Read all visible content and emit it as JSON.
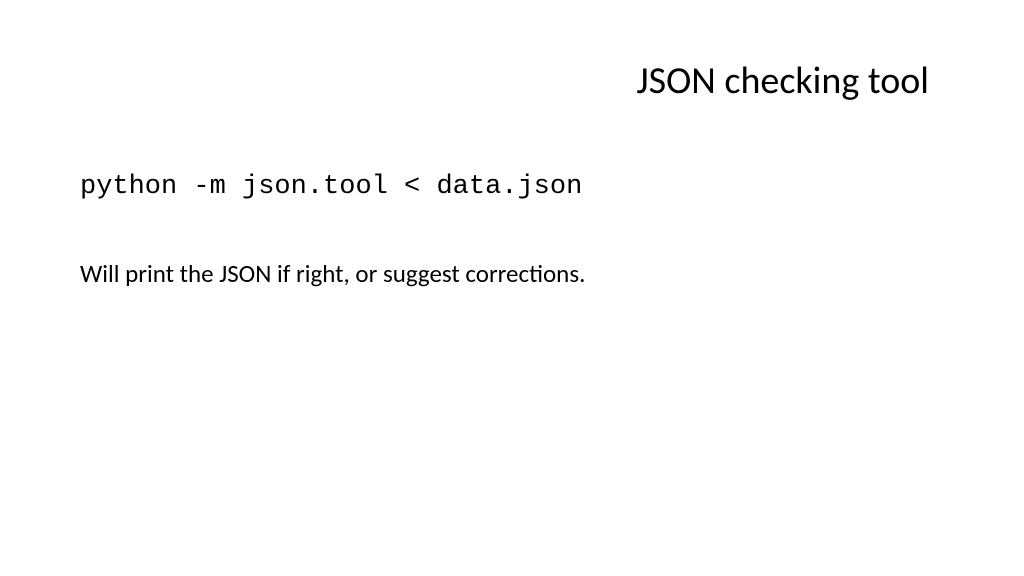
{
  "slide": {
    "title": "JSON checking tool",
    "code": "python -m json.tool < data.json",
    "description": "Will print the JSON if right, or suggest corrections."
  }
}
